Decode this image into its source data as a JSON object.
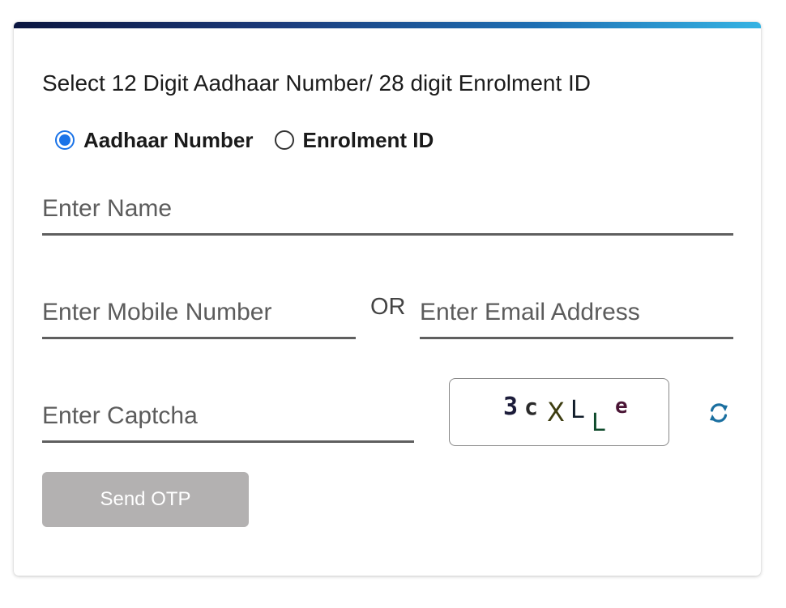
{
  "form": {
    "instruction": "Select 12 Digit Aadhaar Number/ 28 digit Enrolment ID",
    "id_type_options": [
      {
        "label": "Aadhaar Number",
        "selected": true
      },
      {
        "label": "Enrolment ID",
        "selected": false
      }
    ],
    "name_field": {
      "placeholder": "Enter Name",
      "value": ""
    },
    "mobile_field": {
      "placeholder": "Enter Mobile Number",
      "value": ""
    },
    "or_text": "OR",
    "email_field": {
      "placeholder": "Enter Email Address",
      "value": ""
    },
    "captcha_field": {
      "placeholder": "Enter Captcha",
      "value": ""
    },
    "captcha_image_text": "3cXLLe",
    "refresh_icon": "refresh-icon",
    "send_otp_label": "Send OTP"
  },
  "colors": {
    "accent": "#1a73e8",
    "top_bar_start": "#0b1640",
    "top_bar_end": "#35b3e3",
    "button_disabled": "#b3b1b1",
    "refresh_icon": "#1a6fa0"
  }
}
